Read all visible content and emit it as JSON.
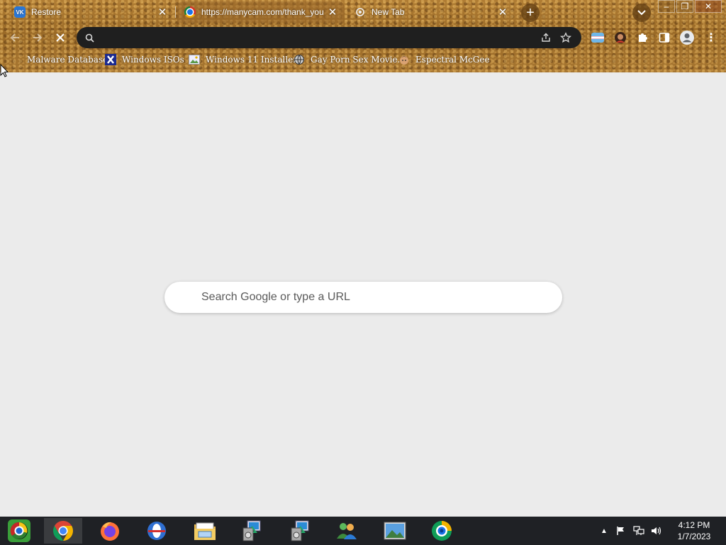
{
  "tabs": [
    {
      "title": "Restore",
      "favicon": "vk-icon",
      "active": false
    },
    {
      "title": "https://manycam.com/thank_you",
      "favicon": "chrome-globe-icon",
      "active": true
    },
    {
      "title": "New Tab",
      "favicon": "new-tab-icon",
      "active": false
    }
  ],
  "toolbar": {
    "omnibox_value": ""
  },
  "bookmarks": [
    {
      "label": "Malware Database",
      "icon": ""
    },
    {
      "label": "Windows ISOs",
      "icon": "x-icon"
    },
    {
      "label": "Windows 11 Installer",
      "icon": "image-icon"
    },
    {
      "label": "Gay Porn Sex Movie...",
      "icon": "globe-icon"
    },
    {
      "label": "Espectral McGee",
      "icon": "face-icon"
    }
  ],
  "ntp": {
    "search_placeholder": "Search Google or type a URL"
  },
  "taskbar": {
    "apps": [
      "start-orb",
      "chrome",
      "firefox",
      "opera",
      "file-explorer",
      "installer",
      "installer-2",
      "messenger",
      "photos",
      "manycam"
    ]
  },
  "clock": {
    "time": "4:12 PM",
    "date": "1/7/2023"
  },
  "colors": {
    "omnibox_bg": "#1f1f1f",
    "page_bg": "#ebebeb",
    "taskbar_bg": "#1f2125"
  }
}
